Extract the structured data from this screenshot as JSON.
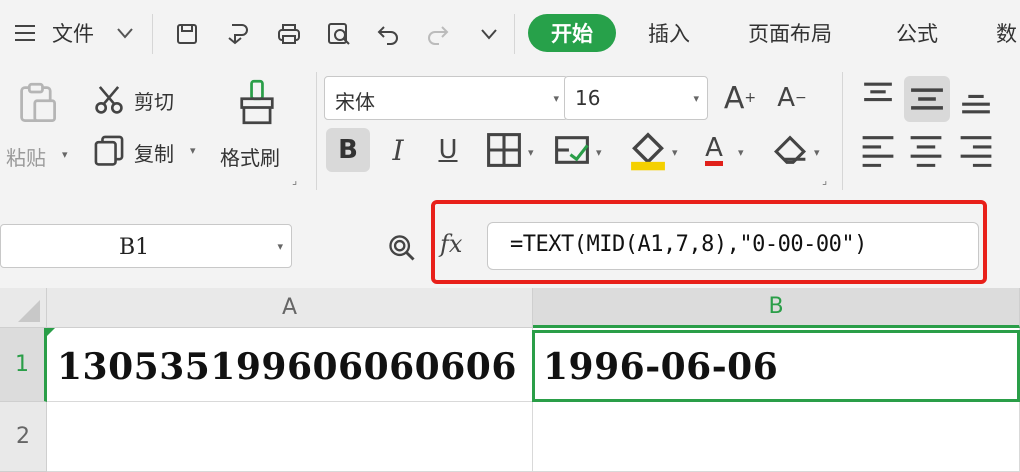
{
  "menu": {
    "hamburger_icon": "menu-icon",
    "file_label": "文件",
    "tabs": [
      "开始",
      "插入",
      "页面布局",
      "公式",
      "数"
    ],
    "active_tab": "开始",
    "accent_color": "#27a14a"
  },
  "ribbon": {
    "paste_label": "粘贴",
    "cut_label": "剪切",
    "copy_label": "复制",
    "format_painter_label": "格式刷",
    "font_name": "宋体",
    "font_size": "16",
    "increase_font_glyph": "A",
    "decrease_font_glyph": "A",
    "bold_glyph": "B",
    "italic_glyph": "I",
    "underline_glyph": "U",
    "font_color_glyph": "A"
  },
  "formula_bar": {
    "name_box": "B1",
    "fx_label": "fx",
    "formula": "=TEXT(MID(A1,7,8),\"0-00-00\")",
    "highlight_color": "#e8201a"
  },
  "sheet": {
    "columns": [
      "A",
      "B"
    ],
    "rows": [
      "1",
      "2"
    ],
    "cells": {
      "A1": "130535199606060606",
      "B1": "1996-06-06"
    },
    "active_cell": "B1",
    "selection_color": "#2a9e48"
  }
}
